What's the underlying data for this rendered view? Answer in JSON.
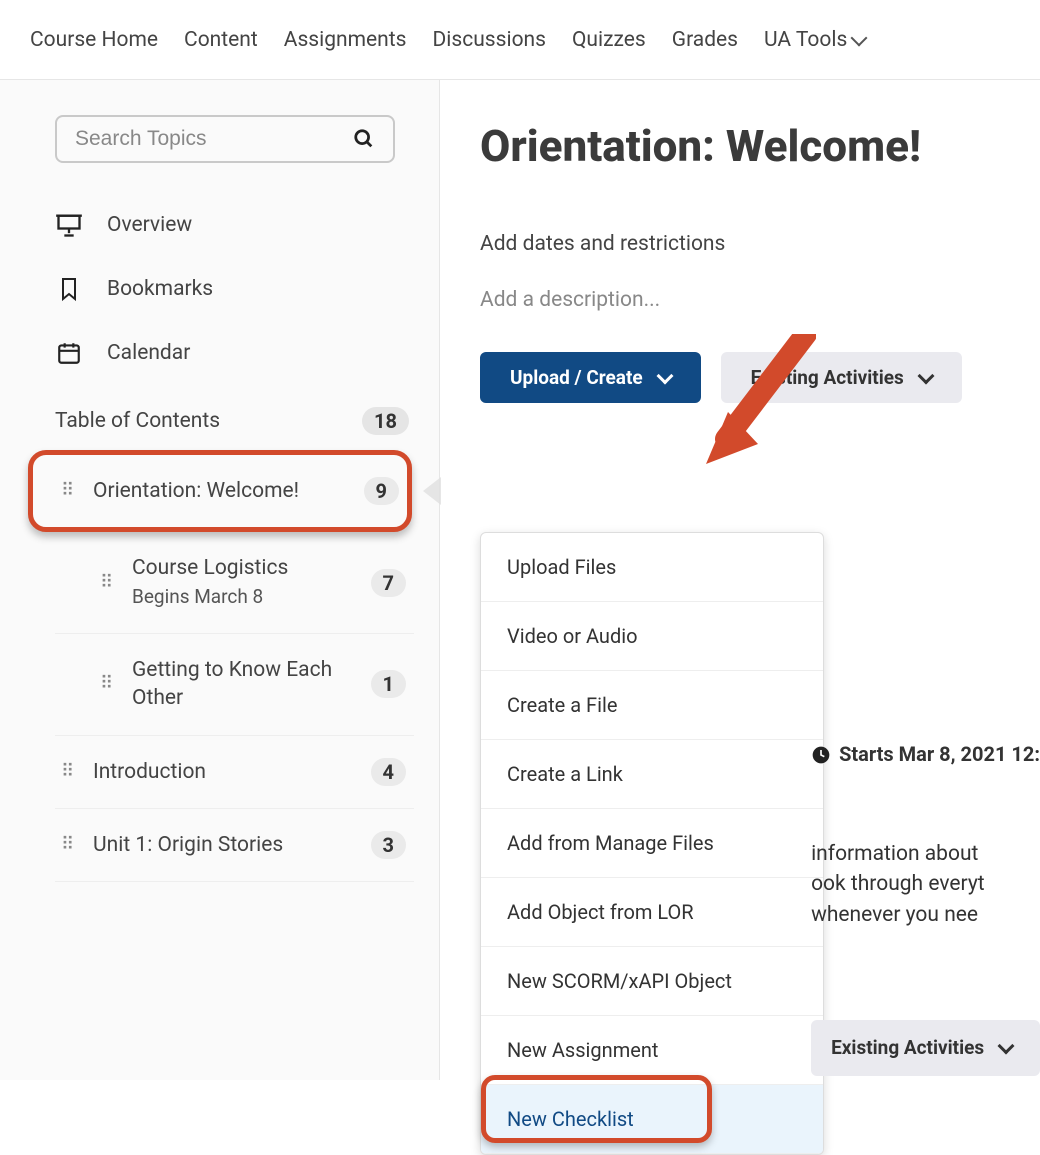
{
  "nav": {
    "items": [
      "Course Home",
      "Content",
      "Assignments",
      "Discussions",
      "Quizzes",
      "Grades",
      "UA Tools"
    ]
  },
  "sidebar": {
    "search_placeholder": "Search Topics",
    "overview": "Overview",
    "bookmarks": "Bookmarks",
    "calendar": "Calendar",
    "toc_label": "Table of Contents",
    "toc_count": "18",
    "modules": [
      {
        "title": "Orientation: Welcome!",
        "count": "9",
        "selected": true
      },
      {
        "title": "Course Logistics",
        "sub": "Begins March 8",
        "count": "7",
        "indent": true
      },
      {
        "title": "Getting to Know Each Other",
        "count": "1",
        "indent": true
      },
      {
        "title": "Introduction",
        "count": "4"
      },
      {
        "title": "Unit 1: Origin Stories",
        "count": "3"
      }
    ]
  },
  "main": {
    "title": "Orientation: Welcome!",
    "add_dates": "Add dates and restrictions",
    "add_description": "Add a description...",
    "upload_create_label": "Upload / Create",
    "existing_activities_label": "Existing Activities",
    "menu": [
      "Upload Files",
      "Video or Audio",
      "Create a File",
      "Create a Link",
      "Add from Manage Files",
      "Add Object from LOR",
      "New SCORM/xAPI Object",
      "New Assignment",
      "New Checklist"
    ],
    "menu_highlight_index": 8,
    "starts_text": "Starts Mar 8, 2021 12:",
    "hint_lines": [
      "information about",
      "ook through everyt",
      "whenever you nee"
    ]
  }
}
